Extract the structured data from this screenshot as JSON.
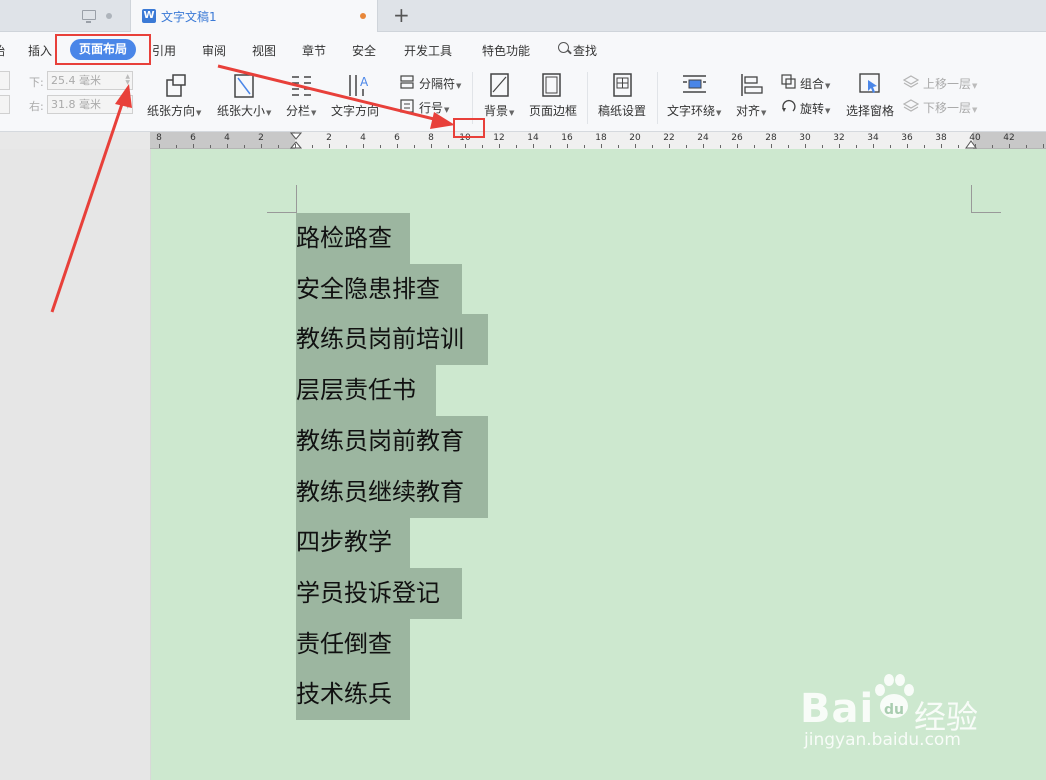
{
  "tabbar": {
    "doc_tab_title": "文字文稿1",
    "doc_icon_letter": "W",
    "add_tab": "+"
  },
  "menu": {
    "partial_first": "始",
    "items": [
      "插入",
      "页面布局",
      "引用",
      "审阅",
      "视图",
      "章节",
      "安全",
      "开发工具",
      "特色功能",
      "查找"
    ],
    "active": "页面布局"
  },
  "margins": {
    "bottom_label": "下:",
    "bottom_value": "25.4 毫米",
    "right_label": "右:",
    "right_value": "31.8 毫米"
  },
  "toolbar": {
    "paper_orientation": "纸张方向",
    "paper_size": "纸张大小",
    "columns": "分栏",
    "text_direction": "文字方向",
    "separator": "分隔符",
    "line_number": "行号",
    "background": "背景",
    "page_border": "页面边框",
    "manuscript": "稿纸设置",
    "text_wrap": "文字环绕",
    "align": "对齐",
    "group": "组合",
    "rotate": "旋转",
    "selection_pane": "选择窗格",
    "bring_forward": "上移一层",
    "send_backward": "下移一层"
  },
  "ruler": {
    "labels": [
      "8",
      "6",
      "4",
      "2",
      "2",
      "4",
      "6",
      "8",
      "10",
      "12",
      "14",
      "16",
      "18",
      "20",
      "22",
      "24",
      "26",
      "28",
      "30",
      "32",
      "34",
      "36",
      "38",
      "40",
      "42"
    ]
  },
  "document": {
    "lines": [
      "路检路查",
      "安全隐患排查",
      "教练员岗前培训",
      "层层责任书",
      "教练员岗前教育",
      "教练员继续教育",
      "四步教学",
      "学员投诉登记",
      "责任倒查",
      "技术练兵"
    ]
  },
  "watermark": {
    "brand": "Bai",
    "brand_tail": "经验",
    "url": "jingyan.baidu.com"
  },
  "colors": {
    "accent": "#4a86e8",
    "page_bg": "#cde8cf",
    "highlight": "#9cb6a0",
    "annotation": "#e8403a"
  }
}
